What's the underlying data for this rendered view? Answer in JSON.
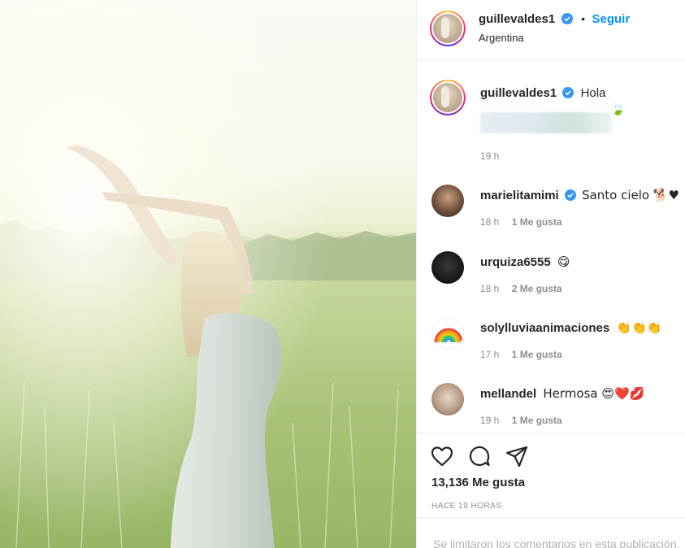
{
  "post": {
    "author": "guillevaldes1",
    "location": "Argentina",
    "follow_label": "Seguir",
    "separator": "•"
  },
  "caption": {
    "username": "guillevaldes1",
    "text": "Hola",
    "emoji": "🍃",
    "time": "19 h"
  },
  "comments": [
    {
      "username": "marielitamimi",
      "verified": true,
      "text": "Santo cielo 🐕♥",
      "time": "18 h",
      "likes": "1 Me gusta"
    },
    {
      "username": "urquiza6555",
      "verified": false,
      "text": "😋",
      "time": "18 h",
      "likes": "2 Me gusta"
    },
    {
      "username": "solylluviaanimaciones",
      "verified": false,
      "text": "👏👏👏",
      "time": "17 h",
      "likes": "1 Me gusta"
    },
    {
      "username": "mellandel",
      "verified": false,
      "text": "Hermosa 😍❤️💋",
      "time": "19 h",
      "likes": "1 Me gusta"
    }
  ],
  "stats": {
    "likes": "13,136 Me gusta",
    "posted": "HACE 19 HORAS"
  },
  "comment_box": {
    "placeholder": "Se limitaron los comentarios en esta publicación."
  },
  "icons": [
    "heart-icon",
    "comment-icon",
    "share-icon",
    "verified-icon"
  ],
  "colors": {
    "accent": "#0095f6",
    "verified": "#3897f0",
    "muted": "#8e8e8e"
  }
}
